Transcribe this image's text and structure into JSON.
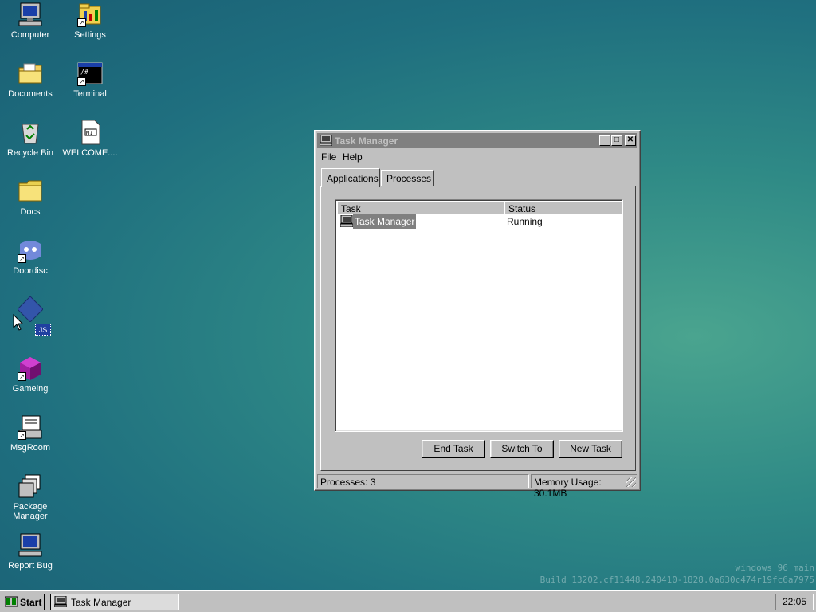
{
  "desktop": {
    "icons": [
      {
        "label": "Computer",
        "icon": "computer-icon"
      },
      {
        "label": "Settings",
        "icon": "settings-icon"
      },
      {
        "label": "Documents",
        "icon": "documents-folder-icon"
      },
      {
        "label": "Terminal",
        "icon": "terminal-icon"
      },
      {
        "label": "Recycle Bin",
        "icon": "recycle-bin-icon"
      },
      {
        "label": "WELCOME....",
        "icon": "document-icon"
      },
      {
        "label": "Docs",
        "icon": "folder-icon"
      },
      {
        "label": "Doordisc",
        "icon": "doordisc-icon"
      },
      {
        "label": "",
        "icon": "js-app-icon",
        "badge": "JS"
      },
      {
        "label": "Gameing",
        "icon": "game-cube-icon"
      },
      {
        "label": "MsgRoom",
        "icon": "msgroom-icon"
      },
      {
        "label": "Package Manager",
        "icon": "package-manager-icon"
      },
      {
        "label": "Report Bug",
        "icon": "report-bug-icon"
      }
    ],
    "watermark_line1": "windows 96 main",
    "watermark_line2": "Build 13202.cf11448.240410-1828.0a630c474r19fc6a7975"
  },
  "window": {
    "title": "Task Manager",
    "controls": {
      "minimize": "_",
      "maximize": "□",
      "close": "✕"
    },
    "menu": [
      "File",
      "Help"
    ],
    "tabs": [
      {
        "label": "Applications",
        "active": true
      },
      {
        "label": "Processes",
        "active": false
      }
    ],
    "columns": [
      "Task",
      "Status"
    ],
    "rows": [
      {
        "task": "Task Manager",
        "status": "Running"
      }
    ],
    "buttons": {
      "end_task": "End Task",
      "switch_to": "Switch To",
      "new_task": "New Task"
    },
    "status": {
      "processes": "Processes: 3",
      "memory": "Memory Usage: 30.1MB"
    }
  },
  "taskbar": {
    "start_label": "Start",
    "tasks": [
      {
        "label": "Task Manager"
      }
    ],
    "clock": "22:05"
  },
  "colors": {
    "desktop": "#1f6f7f",
    "chrome": "#c0c0c0",
    "inactive_title": "#808080",
    "selection": "#808080"
  }
}
